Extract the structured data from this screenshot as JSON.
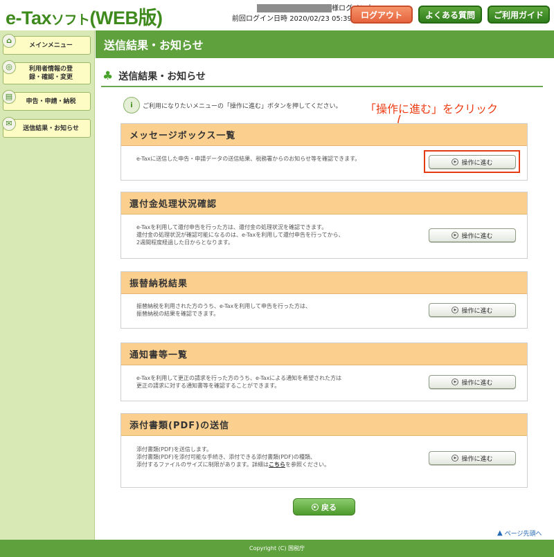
{
  "header": {
    "logo_main": "e-Tax",
    "logo_small": "ソフト",
    "logo_suffix": "(WEB版)",
    "login_status": "様ログイン中",
    "last_login_label": "前回ログイン日時",
    "last_login_value": "2020/02/23 05:39",
    "logout_label": "ログアウト",
    "faq_label": "よくある質問",
    "guide_label": "ご利用ガイド"
  },
  "sidebar": {
    "items": [
      {
        "label": "メインメニュー",
        "icon": "home-icon"
      },
      {
        "label": "利用者情報の登録・確認・変更",
        "icon": "user-settings-icon"
      },
      {
        "label": "申告・申請・納税",
        "icon": "document-icon"
      },
      {
        "label": "送信結果・お知らせ",
        "icon": "mail-icon"
      }
    ]
  },
  "main": {
    "title": "送信結果・お知らせ",
    "section_title": "送信結果・お知らせ",
    "intro": "ご利用になりたいメニューの「操作に進む」ボタンを押してください。",
    "annotation": "「操作に進む」をクリック",
    "proceed_label": "操作に進む",
    "panels": [
      {
        "title": "メッセージボックス一覧",
        "lines": [
          "e-Taxに送信した申告・申請データの送信結果、税務署からのお知らせ等を確認できます。"
        ]
      },
      {
        "title": "還付金処理状況確認",
        "lines": [
          "e-Taxを利用して還付申告を行った方は、還付金の処理状況を確認できます。",
          "還付金の処理状況が確認可能になるのは、e-Taxを利用して還付申告を行ってから、",
          "2週間程度経過した日からとなります。"
        ]
      },
      {
        "title": "振替納税結果",
        "lines": [
          "振替納税を利用された方のうち、e-Taxを利用して申告を行った方は、",
          "振替納税の結果を確認できます。"
        ]
      },
      {
        "title": "通知書等一覧",
        "lines": [
          "e-Taxを利用して更正の請求を行った方のうち、e-Taxによる通知を希望された方は",
          "更正の請求に対する通知書等を確認することができます。"
        ]
      },
      {
        "title": "添付書類(PDF)の送信",
        "lines": [
          "添付書類(PDF)を送信します。",
          "添付書類(PDF)を添付可能な手続き、添付できる添付書類(PDF)の種類、",
          "添付するファイルのサイズに制限があります。詳細は"
        ],
        "link_text": "こちら",
        "after_link": "を参照ください。"
      }
    ],
    "back_label": "戻る",
    "page_top_label": "ページ先頭へ"
  },
  "footer": {
    "copyright": "Copyright (C) 国税庁"
  },
  "colors": {
    "brand_green": "#5fa13d",
    "panel_header": "#fbd08f",
    "logout_orange": "#e5643e",
    "annotation_red": "#ee3b12"
  }
}
